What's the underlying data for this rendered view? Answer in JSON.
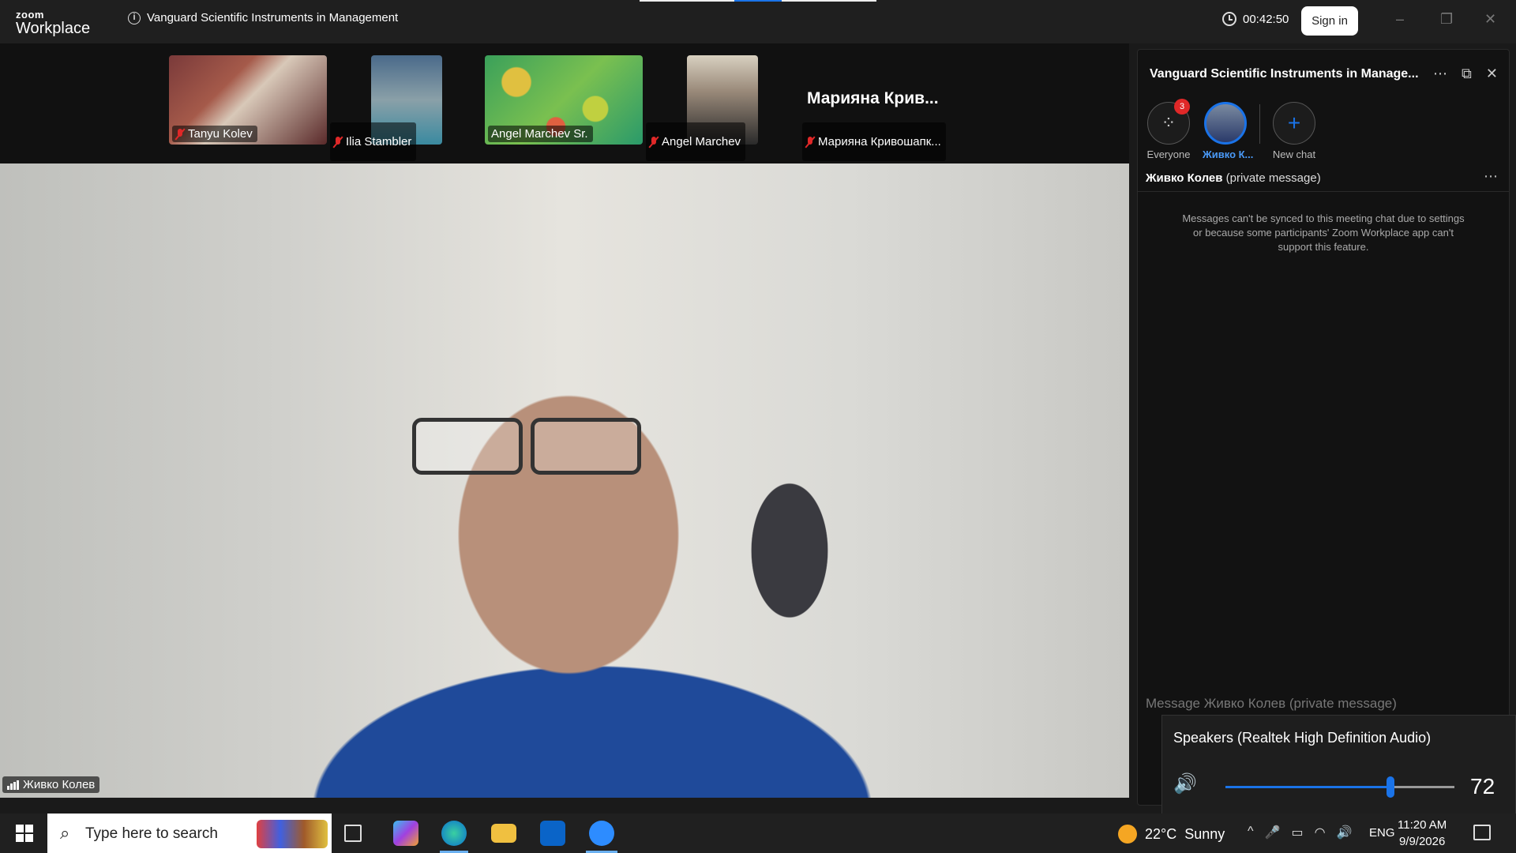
{
  "app": {
    "logo_line1": "zoom",
    "logo_line2": "Workplace",
    "meeting_title": "Vanguard Scientific Instruments in Management",
    "timer": "00:42:50",
    "sign_in": "Sign in",
    "win_minimize": "–",
    "win_restore": "❐",
    "win_close": "✕"
  },
  "thumbnails": [
    {
      "name": "Tanyu Kolev",
      "muted": true
    },
    {
      "name": "Ilia Stambler",
      "muted": true
    },
    {
      "name": "Angel Marchev Sr.",
      "muted": false
    },
    {
      "name": "Angel Marchev",
      "muted": true
    },
    {
      "name": "Мариянa Кривошапк...",
      "display_name": "Мариянa Крив...",
      "muted": true
    }
  ],
  "main_video": {
    "speaker_name": "Живко Колев"
  },
  "chat": {
    "title": "Vanguard Scientific Instruments in Manage...",
    "more_icon": "⋯",
    "popout_icon": "⧉",
    "close_icon": "✕",
    "recipients": [
      {
        "label": "Everyone",
        "badge": "3",
        "icon": "⁘"
      },
      {
        "label": "Живко К...",
        "active": true
      },
      {
        "label": "New chat",
        "icon": "+"
      }
    ],
    "pm_name": "Живко Колев",
    "pm_suffix": " (private message)",
    "pm_more": "⋯",
    "sync_note": "Messages can't be synced to this meeting chat due to settings or because some participants' Zoom Workplace app can't support this feature.",
    "input_placeholder": "Message Живко Колев (private message)"
  },
  "volume": {
    "device": "Speakers (Realtek High Definition Audio)",
    "level": 72,
    "level_text": "72",
    "speaker_icon": "🔊"
  },
  "taskbar": {
    "search_placeholder": "Type here to search",
    "search_icon": "⌕",
    "temperature": "22°C",
    "weather": "Sunny",
    "language": "ENG",
    "time": "11:20 AM",
    "date": "9/9/2026",
    "tray_icons": [
      "^",
      "🎤",
      "▭",
      "◠",
      "🔊"
    ]
  },
  "colors": {
    "accent": "#1a73e8",
    "muted": "#e02828"
  }
}
